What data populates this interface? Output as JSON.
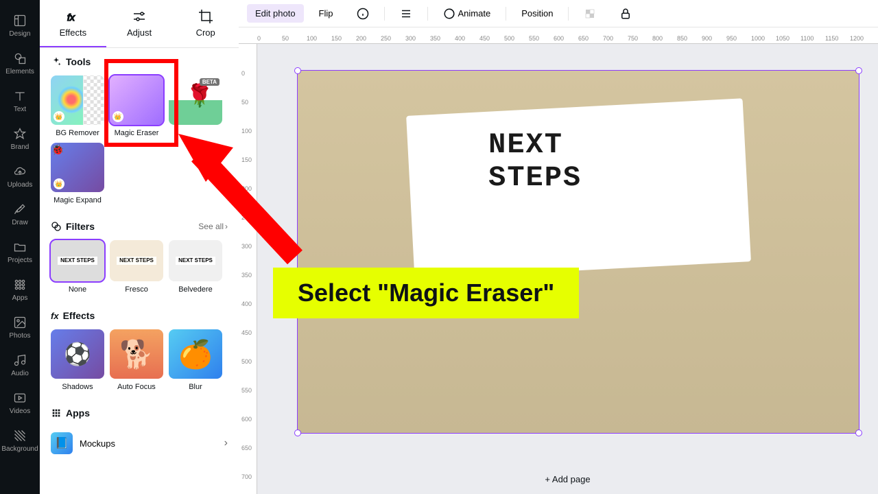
{
  "sidebar": {
    "items": [
      {
        "label": "Design"
      },
      {
        "label": "Elements"
      },
      {
        "label": "Text"
      },
      {
        "label": "Brand"
      },
      {
        "label": "Uploads"
      },
      {
        "label": "Draw"
      },
      {
        "label": "Projects"
      },
      {
        "label": "Apps"
      },
      {
        "label": "Photos"
      },
      {
        "label": "Audio"
      },
      {
        "label": "Videos"
      },
      {
        "label": "Background"
      }
    ]
  },
  "panel": {
    "tabs": [
      {
        "label": "Effects"
      },
      {
        "label": "Adjust"
      },
      {
        "label": "Crop"
      }
    ],
    "tools": {
      "title": "Tools",
      "items": [
        {
          "label": "BG Remover"
        },
        {
          "label": "Magic Eraser"
        },
        {
          "label": "",
          "beta": "BETA"
        },
        {
          "label": "Magic Expand"
        }
      ]
    },
    "filters": {
      "title": "Filters",
      "see_all": "See all",
      "items": [
        {
          "label": "None"
        },
        {
          "label": "Fresco"
        },
        {
          "label": "Belvedere"
        }
      ]
    },
    "effects": {
      "title": "Effects",
      "items": [
        {
          "label": "Shadows"
        },
        {
          "label": "Auto Focus"
        },
        {
          "label": "Blur"
        }
      ]
    },
    "apps": {
      "title": "Apps",
      "items": [
        {
          "label": "Mockups"
        }
      ]
    }
  },
  "toolbar": {
    "edit_photo": "Edit photo",
    "flip": "Flip",
    "animate": "Animate",
    "position": "Position"
  },
  "ruler": {
    "h": [
      "0",
      "50",
      "100",
      "150",
      "200",
      "250",
      "300",
      "350",
      "400",
      "450",
      "500",
      "550",
      "600",
      "650",
      "700",
      "750",
      "800",
      "850",
      "900",
      "950",
      "1000",
      "1050",
      "1100",
      "1150",
      "1200"
    ],
    "v": [
      "0",
      "50",
      "100",
      "150",
      "200",
      "250",
      "300",
      "350",
      "400",
      "450",
      "500",
      "550",
      "600",
      "650",
      "700"
    ]
  },
  "canvas": {
    "notepad_text": "NEXT\nSTEPS",
    "add_page": "+ Add page",
    "filter_thumb_text": "NEXT\nSTEPS"
  },
  "annotation": {
    "text": "Select \"Magic Eraser\""
  }
}
